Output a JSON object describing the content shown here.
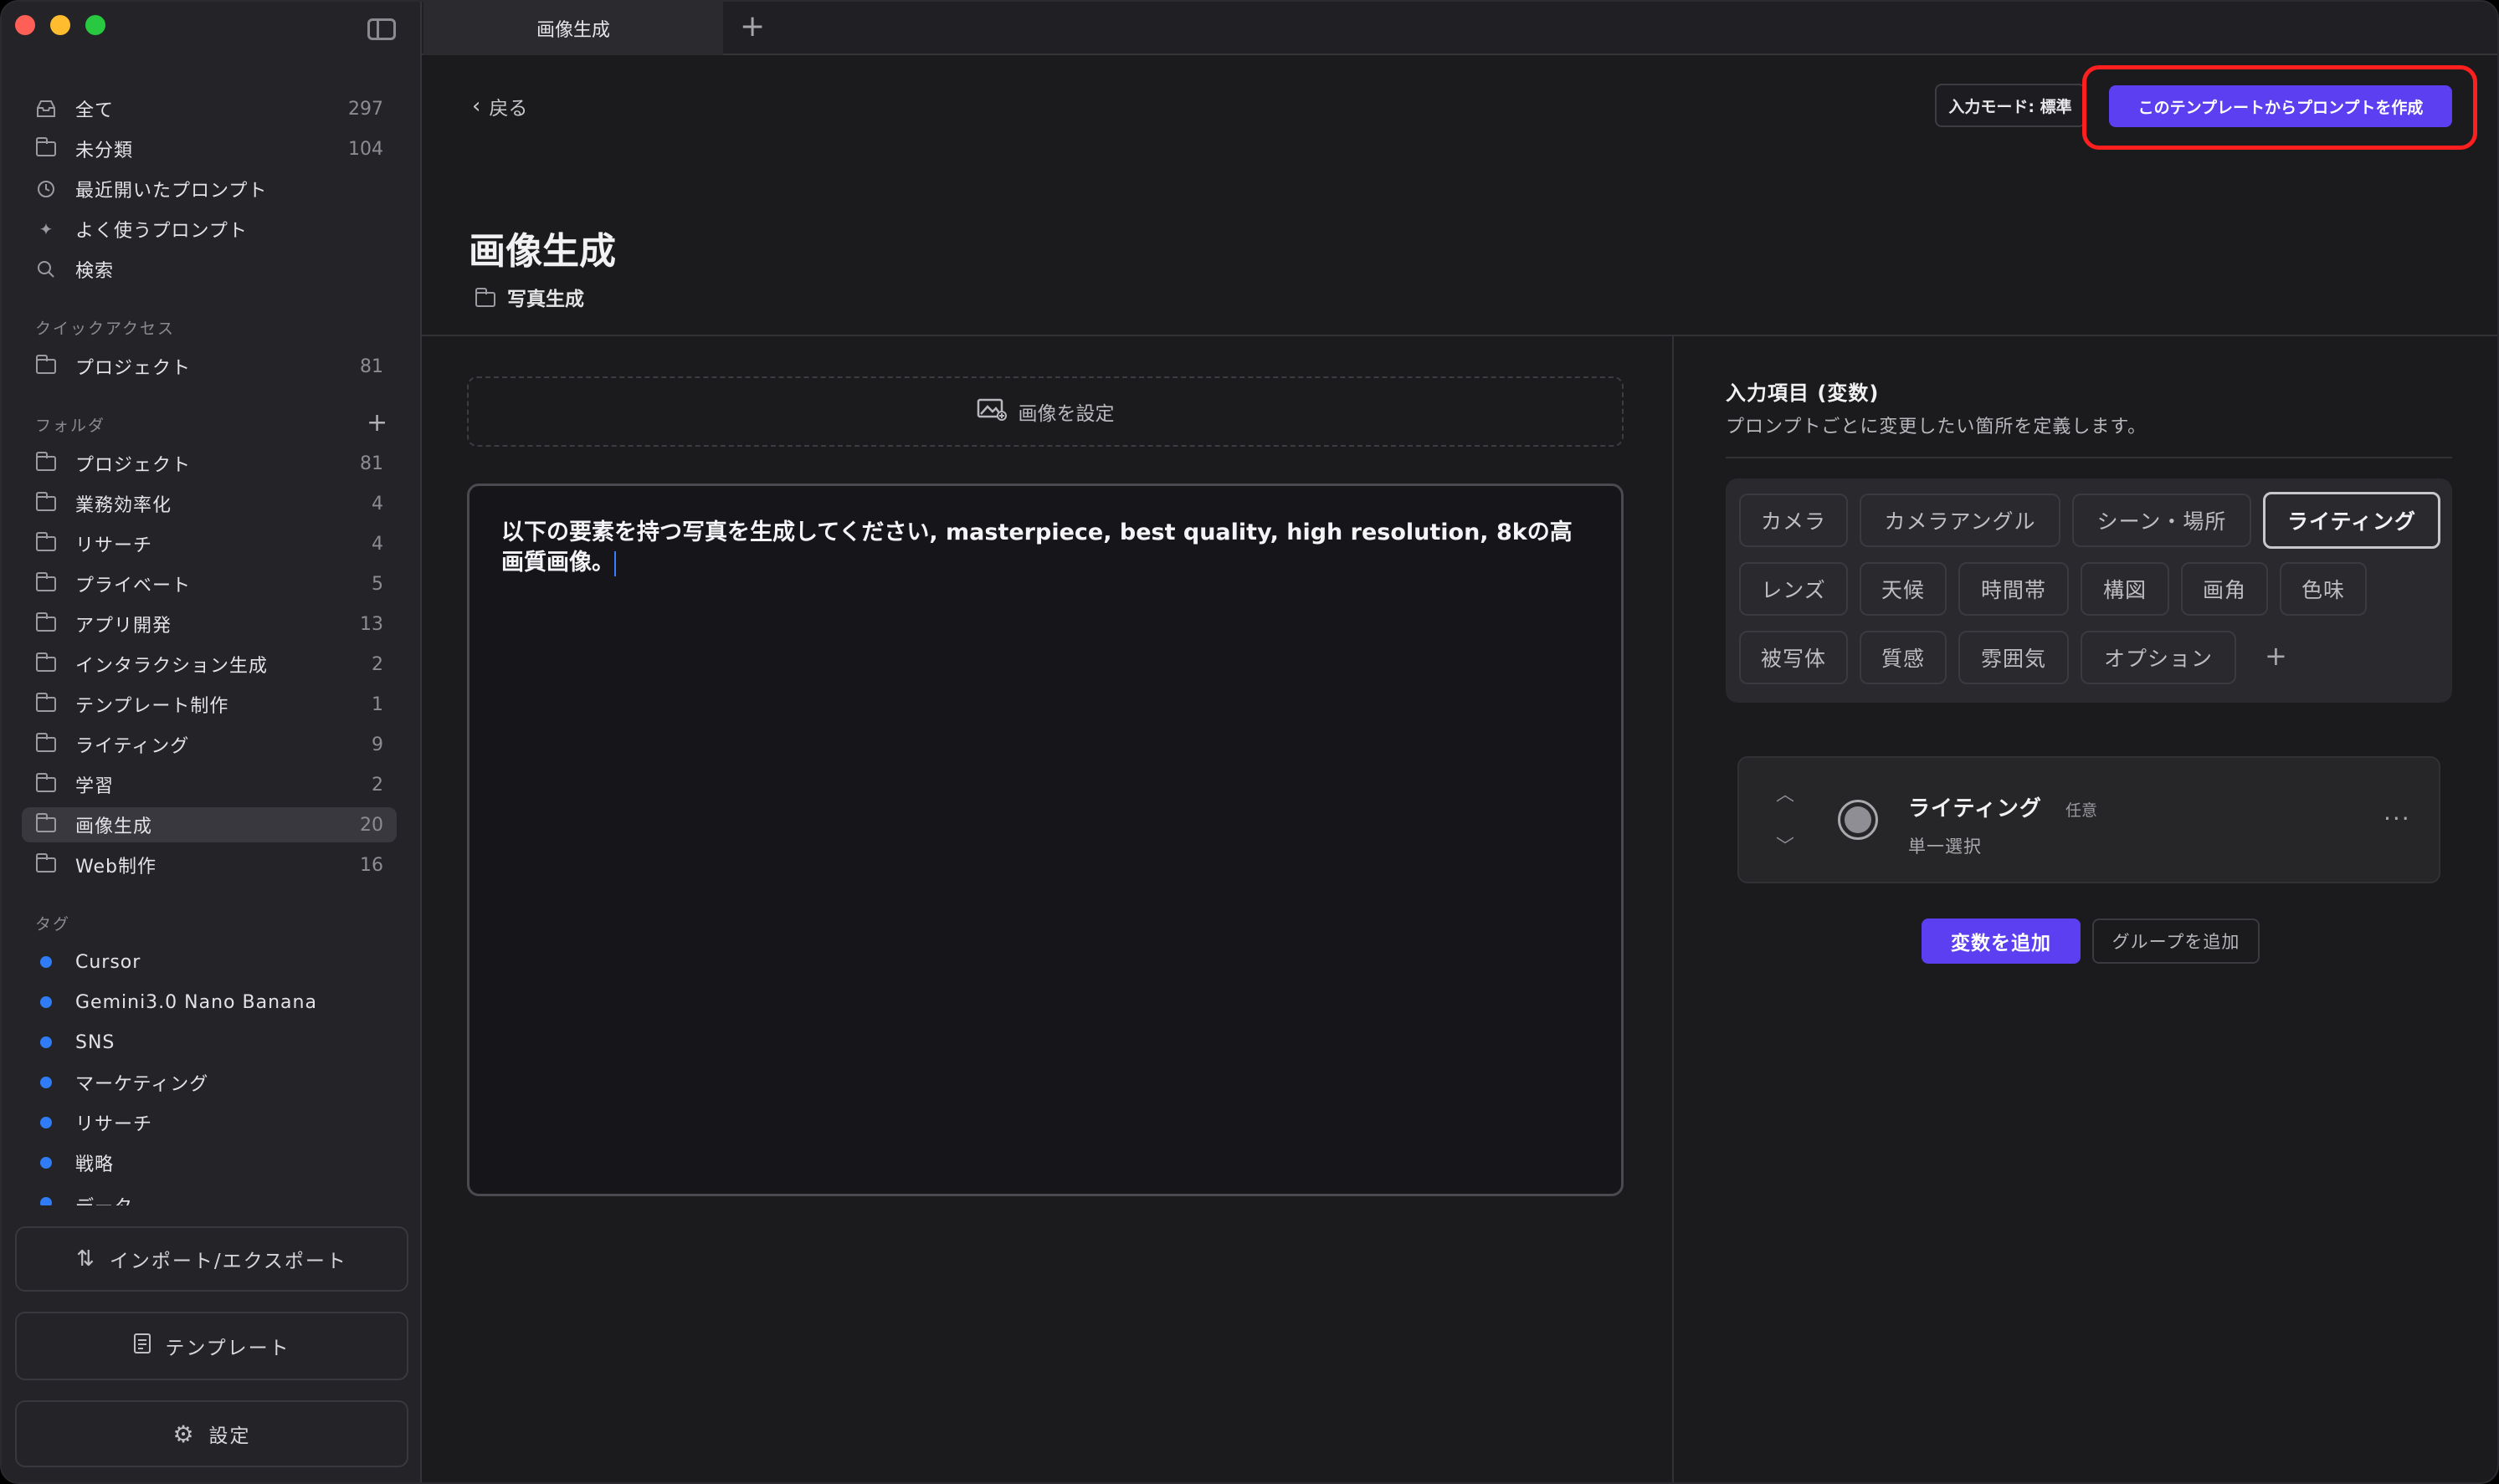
{
  "sidebar": {
    "nav": [
      {
        "label": "全て",
        "count": "297",
        "icon": "inbox-icon"
      },
      {
        "label": "未分類",
        "count": "104",
        "icon": "folder-icon"
      },
      {
        "label": "最近開いたプロンプト",
        "count": "",
        "icon": "clock-icon"
      },
      {
        "label": "よく使うプロンプト",
        "count": "",
        "icon": "sparkle-icon"
      },
      {
        "label": "検索",
        "count": "",
        "icon": "search-icon"
      }
    ],
    "quick_access_heading": "クイックアクセス",
    "quick_access": [
      {
        "label": "プロジェクト",
        "count": "81"
      }
    ],
    "folders_heading": "フォルダ",
    "folders": [
      {
        "label": "プロジェクト",
        "count": "81"
      },
      {
        "label": "業務効率化",
        "count": "4"
      },
      {
        "label": "リサーチ",
        "count": "4"
      },
      {
        "label": "プライベート",
        "count": "5"
      },
      {
        "label": "アプリ開発",
        "count": "13"
      },
      {
        "label": "インタラクション生成",
        "count": "2"
      },
      {
        "label": "テンプレート制作",
        "count": "1"
      },
      {
        "label": "ライティング",
        "count": "9"
      },
      {
        "label": "学習",
        "count": "2"
      },
      {
        "label": "画像生成",
        "count": "20",
        "active": true
      },
      {
        "label": "Web制作",
        "count": "16"
      }
    ],
    "tags_heading": "タグ",
    "tags": [
      {
        "label": "Cursor"
      },
      {
        "label": "Gemini3.0 Nano Banana"
      },
      {
        "label": "SNS"
      },
      {
        "label": "マーケティング"
      },
      {
        "label": "リサーチ"
      },
      {
        "label": "戦略"
      },
      {
        "label": "データ"
      }
    ],
    "import_export_label": "インポート/エクスポート",
    "template_label": "テンプレート",
    "settings_label": "設定"
  },
  "tabs": [
    {
      "label": "画像生成"
    }
  ],
  "header": {
    "back_label": "戻る",
    "mode_label": "入力モード: 標準",
    "create_label": "このテンプレートからプロンプトを作成",
    "title": "画像生成",
    "folder": "写真生成"
  },
  "editor": {
    "image_slot_label": "画像を設定",
    "prompt_text": "以下の要素を持つ写真を生成してください, masterpiece, best quality, high resolution, 8kの高画質画像。"
  },
  "variables": {
    "title": "入力項目 (変数)",
    "subtitle": "プロンプトごとに変更したい箇所を定義します。",
    "chips": [
      "カメラ",
      "カメラアングル",
      "シーン・場所",
      "ライティング",
      "レンズ",
      "天候",
      "時間帯",
      "構図",
      "画角",
      "色味",
      "被写体",
      "質感",
      "雰囲気",
      "オプション"
    ],
    "selected_chip": "ライティング",
    "card": {
      "name": "ライティング",
      "optional": "任意",
      "type": "単一選択"
    },
    "add_variable_label": "変数を追加",
    "add_group_label": "グループを追加"
  },
  "colors": {
    "accent": "#5b3ff0",
    "highlight": "#ff1f1f",
    "tag_dot": "#2f7cf6"
  }
}
